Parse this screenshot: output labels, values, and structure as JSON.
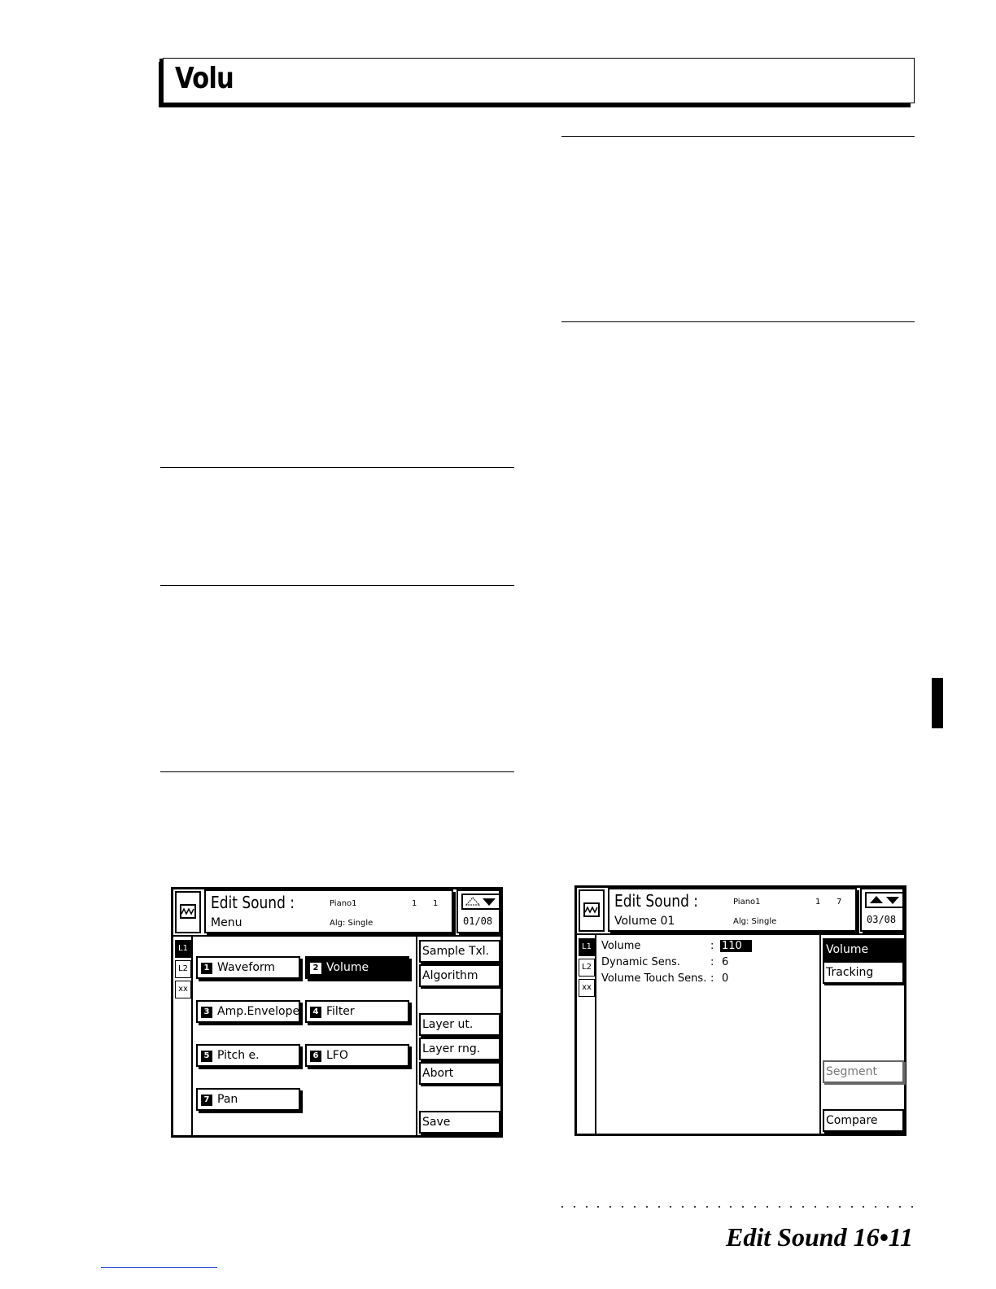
{
  "page": {
    "section_title": "Volu",
    "footer": "Edit Sound   16•11"
  },
  "screen1": {
    "header_title": "Edit Sound :",
    "header_subtitle": "Menu",
    "sound_name": "Piano1",
    "algorithm": "Alg: Single",
    "val_a": "1",
    "val_b": "1",
    "page_indicator": "01/08",
    "layers": [
      "L1",
      "L2",
      "xx"
    ],
    "menu": [
      {
        "num": "1",
        "label": "Waveform"
      },
      {
        "num": "2",
        "label": "Volume"
      },
      {
        "num": "3",
        "label": "Amp.Envelope"
      },
      {
        "num": "4",
        "label": "Filter"
      },
      {
        "num": "5",
        "label": "Pitch e."
      },
      {
        "num": "6",
        "label": "LFO"
      },
      {
        "num": "7",
        "label": "Pan"
      }
    ],
    "selected_menu": "Volume",
    "side_buttons": [
      "Sample Txl.",
      "Algorithm",
      "Layer ut.",
      "Layer rng.",
      "Abort",
      "Save"
    ]
  },
  "screen2": {
    "header_title": "Edit Sound :",
    "header_subtitle": "Volume 01",
    "sound_name": "Piano1",
    "algorithm": "Alg: Single",
    "val_a": "1",
    "val_b": "7",
    "page_indicator": "03/08",
    "layers": [
      "L1",
      "L2",
      "xx"
    ],
    "params": [
      {
        "label": "Volume",
        "sep": ":",
        "value": "110"
      },
      {
        "label": "Dynamic Sens.",
        "sep": ":",
        "value": "6"
      },
      {
        "label": "Volume Touch Sens.",
        "sep": ":",
        "value": "0"
      }
    ],
    "side_buttons": [
      "Volume",
      "Tracking",
      "Segment",
      "Compare"
    ]
  }
}
